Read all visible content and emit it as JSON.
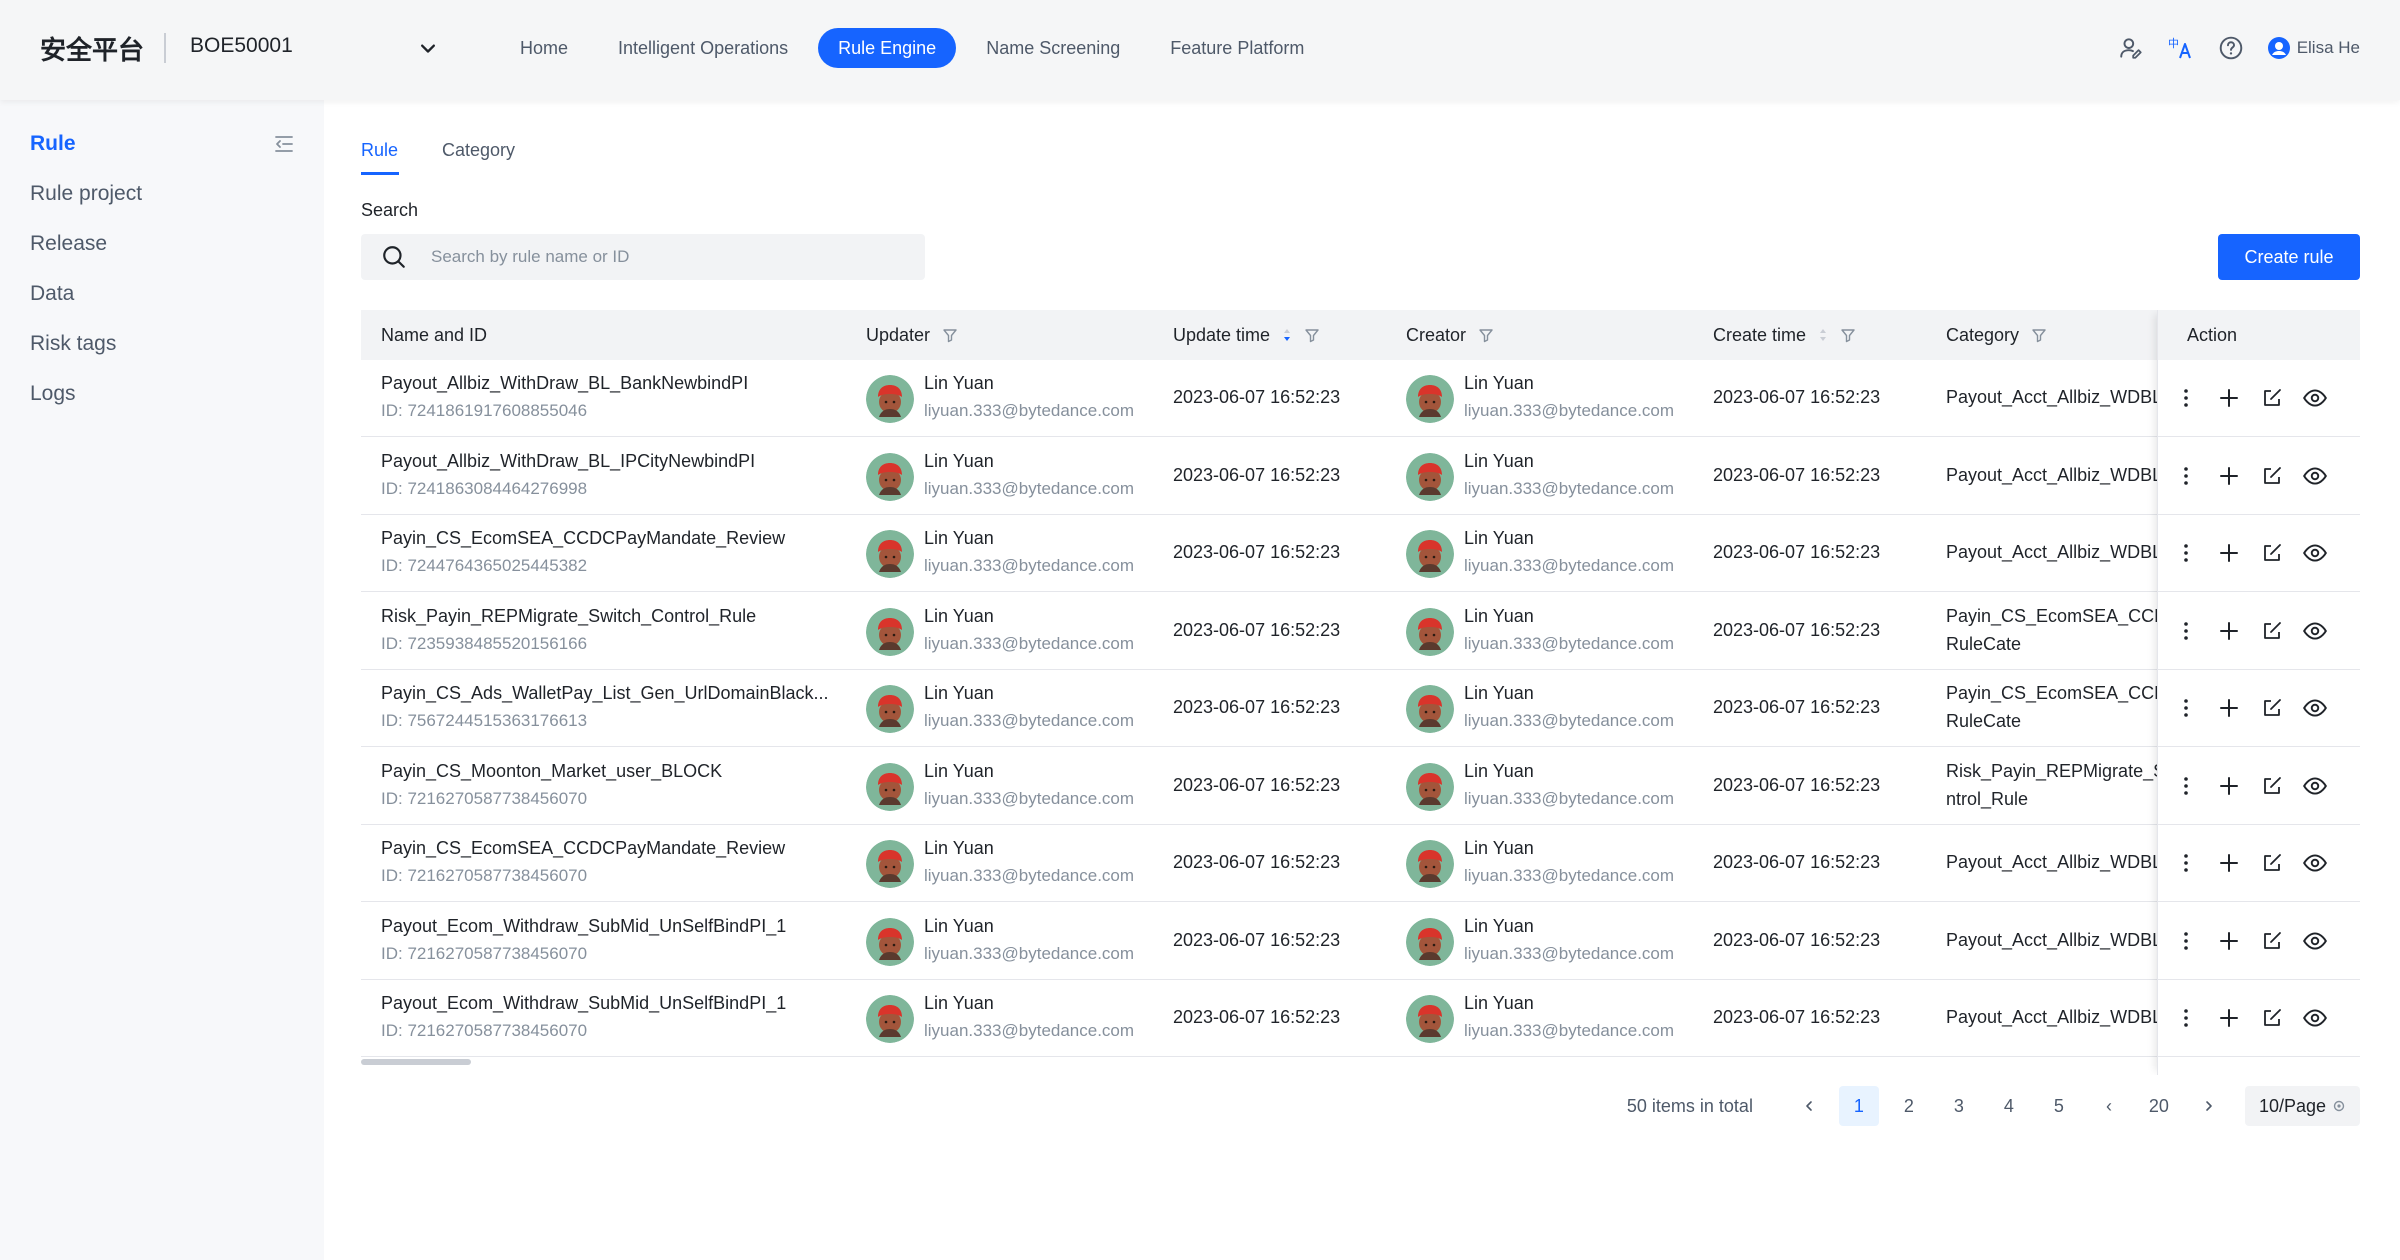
{
  "header": {
    "brand": "安全平台",
    "env": "BOE50001",
    "nav": [
      {
        "label": "Home"
      },
      {
        "label": "Intelligent Operations"
      },
      {
        "label": "Rule Engine",
        "active": true
      },
      {
        "label": "Name Screening"
      },
      {
        "label": "Feature Platform"
      }
    ],
    "user_name": "Elisa He",
    "icons": [
      "user-permission-icon",
      "translate-icon",
      "help-icon",
      "user-avatar-icon"
    ]
  },
  "sidebar": {
    "items": [
      {
        "label": "Rule",
        "active": true
      },
      {
        "label": "Rule project"
      },
      {
        "label": "Release"
      },
      {
        "label": "Data"
      },
      {
        "label": "Risk tags"
      },
      {
        "label": "Logs"
      }
    ]
  },
  "tabs": [
    {
      "label": "Rule",
      "active": true
    },
    {
      "label": "Category"
    }
  ],
  "search": {
    "label": "Search",
    "placeholder": "Search by rule name or ID",
    "value": ""
  },
  "create_button": "Create rule",
  "table": {
    "columns": {
      "name": "Name and ID",
      "updater": "Updater",
      "update_time": "Update time",
      "creator": "Creator",
      "create_time": "Create time",
      "category": "Category",
      "action": "Action"
    },
    "rows": [
      {
        "name": "Payout_Allbiz_WithDraw_BL_BankNewbindPI",
        "id": "ID: 7241861917608855046",
        "updater": "Lin Yuan",
        "updater_email": "liyuan.333@bytedance.com",
        "update_time": "2023-06-07 16:52:23",
        "creator": "Lin Yuan",
        "creator_email": "liyuan.333@bytedance.com",
        "create_time": "2023-06-07 16:52:23",
        "category": [
          "Payout_Acct_Allbiz_WDBL"
        ]
      },
      {
        "name": "Payout_Allbiz_WithDraw_BL_IPCityNewbindPI",
        "id": "ID: 7241863084464276998",
        "updater": "Lin Yuan",
        "updater_email": "liyuan.333@bytedance.com",
        "update_time": "2023-06-07 16:52:23",
        "creator": "Lin Yuan",
        "creator_email": "liyuan.333@bytedance.com",
        "create_time": "2023-06-07 16:52:23",
        "category": [
          "Payout_Acct_Allbiz_WDBL"
        ]
      },
      {
        "name": "Payin_CS_EcomSEA_CCDCPayMandate_Review",
        "id": "ID: 7244764365025445382",
        "updater": "Lin Yuan",
        "updater_email": "liyuan.333@bytedance.com",
        "update_time": "2023-06-07 16:52:23",
        "creator": "Lin Yuan",
        "creator_email": "liyuan.333@bytedance.com",
        "create_time": "2023-06-07 16:52:23",
        "category": [
          "Payout_Acct_Allbiz_WDBL"
        ]
      },
      {
        "name": "Risk_Payin_REPMigrate_Switch_Control_Rule",
        "id": "ID: 7235938485520156166",
        "updater": "Lin Yuan",
        "updater_email": "liyuan.333@bytedance.com",
        "update_time": "2023-06-07 16:52:23",
        "creator": "Lin Yuan",
        "creator_email": "liyuan.333@bytedance.com",
        "create_time": "2023-06-07 16:52:23",
        "category": [
          "Payin_CS_EcomSEA_CCD",
          "RuleCate"
        ]
      },
      {
        "name": "Payin_CS_Ads_WalletPay_List_Gen_UrlDomainBlack...",
        "id": "ID: 7567244515363176613",
        "updater": "Lin Yuan",
        "updater_email": "liyuan.333@bytedance.com",
        "update_time": "2023-06-07 16:52:23",
        "creator": "Lin Yuan",
        "creator_email": "liyuan.333@bytedance.com",
        "create_time": "2023-06-07 16:52:23",
        "category": [
          "Payin_CS_EcomSEA_CCD",
          "RuleCate"
        ]
      },
      {
        "name": "Payin_CS_Moonton_Market_user_BLOCK",
        "id": "ID: 7216270587738456070",
        "updater": "Lin Yuan",
        "updater_email": "liyuan.333@bytedance.com",
        "update_time": "2023-06-07 16:52:23",
        "creator": "Lin Yuan",
        "creator_email": "liyuan.333@bytedance.com",
        "create_time": "2023-06-07 16:52:23",
        "category": [
          "Risk_Payin_REPMigrate_S",
          "ntrol_Rule"
        ]
      },
      {
        "name": "Payin_CS_EcomSEA_CCDCPayMandate_Review",
        "id": "ID: 7216270587738456070",
        "updater": "Lin Yuan",
        "updater_email": "liyuan.333@bytedance.com",
        "update_time": "2023-06-07 16:52:23",
        "creator": "Lin Yuan",
        "creator_email": "liyuan.333@bytedance.com",
        "create_time": "2023-06-07 16:52:23",
        "category": [
          "Payout_Acct_Allbiz_WDBL"
        ]
      },
      {
        "name": "Payout_Ecom_Withdraw_SubMid_UnSelfBindPI_1",
        "id": "ID: 7216270587738456070",
        "updater": "Lin Yuan",
        "updater_email": "liyuan.333@bytedance.com",
        "update_time": "2023-06-07 16:52:23",
        "creator": "Lin Yuan",
        "creator_email": "liyuan.333@bytedance.com",
        "create_time": "2023-06-07 16:52:23",
        "category": [
          "Payout_Acct_Allbiz_WDBL"
        ]
      },
      {
        "name": "Payout_Ecom_Withdraw_SubMid_UnSelfBindPI_1",
        "id": "ID: 7216270587738456070",
        "updater": "Lin Yuan",
        "updater_email": "liyuan.333@bytedance.com",
        "update_time": "2023-06-07 16:52:23",
        "creator": "Lin Yuan",
        "creator_email": "liyuan.333@bytedance.com",
        "create_time": "2023-06-07 16:52:23",
        "category": [
          "Payout_Acct_Allbiz_WDBL"
        ]
      }
    ],
    "row_actions": [
      "more-icon",
      "add-icon",
      "edit-icon",
      "view-icon"
    ]
  },
  "pagination": {
    "total": "50 items in total",
    "pages": [
      "1",
      "2",
      "3",
      "4",
      "5"
    ],
    "ellipsis_label": "‹",
    "last_page": "20",
    "current": "1",
    "page_size": "10/Page"
  },
  "colors": {
    "primary": "#1664ff",
    "header_bg": "#f5f6f7",
    "sidebar_bg": "#f7f8fa",
    "table_head_bg": "#f2f3f5",
    "text": "#1f2329",
    "muted": "#86909c"
  }
}
